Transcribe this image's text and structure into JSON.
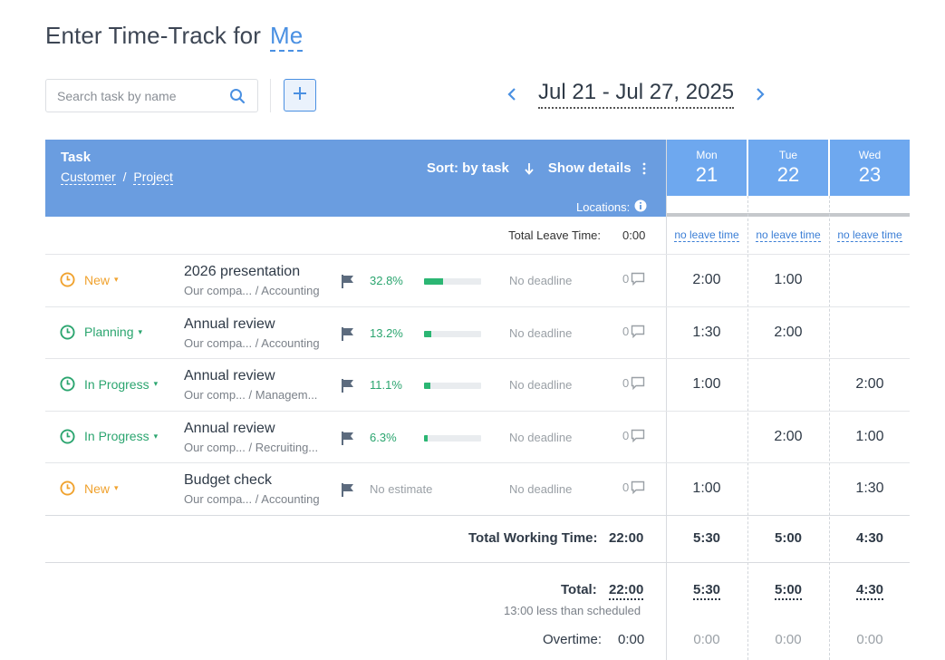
{
  "page": {
    "title": "Enter Time-Track for",
    "user_link": "Me"
  },
  "toolbar": {
    "search_placeholder": "Search task by name",
    "search_icon": "search-icon",
    "add_icon": "plus-icon"
  },
  "date_nav": {
    "range": "Jul 21 - Jul 27, 2025",
    "prev_icon": "chevron-left-icon",
    "next_icon": "chevron-right-icon"
  },
  "table_header": {
    "task": "Task",
    "customer": "Customer",
    "separator": "/",
    "project": "Project",
    "sort_label": "Sort: by task",
    "show_details": "Show details",
    "locations": "Locations:"
  },
  "days": [
    {
      "name": "Mon",
      "date": "21"
    },
    {
      "name": "Tue",
      "date": "22"
    },
    {
      "name": "Wed",
      "date": "23"
    }
  ],
  "leave": {
    "label": "Total Leave Time:",
    "value": "0:00",
    "days": [
      "no leave time",
      "no leave time",
      "no leave time"
    ]
  },
  "tasks": [
    {
      "status": "New",
      "status_color": "#f0a22e",
      "name": "2026 presentation",
      "customer": "Our compa...",
      "project": "/ Accounting",
      "estimate": "32.8%",
      "progress": 0.328,
      "deadline": "No deadline",
      "comments": "0",
      "times": [
        "2:00",
        "1:00",
        ""
      ]
    },
    {
      "status": "Planning",
      "status_color": "#2ba56f",
      "name": "Annual review",
      "customer": "Our compa...",
      "project": "/ Accounting",
      "estimate": "13.2%",
      "progress": 0.132,
      "deadline": "No deadline",
      "comments": "0",
      "times": [
        "1:30",
        "2:00",
        ""
      ]
    },
    {
      "status": "In Progress",
      "status_color": "#2ba56f",
      "name": "Annual review",
      "customer": "Our comp...",
      "project": "/ Managem...",
      "estimate": "11.1%",
      "progress": 0.111,
      "deadline": "No deadline",
      "comments": "0",
      "times": [
        "1:00",
        "",
        "2:00"
      ]
    },
    {
      "status": "In Progress",
      "status_color": "#2ba56f",
      "name": "Annual review",
      "customer": "Our comp...",
      "project": "/ Recruiting...",
      "estimate": "6.3%",
      "progress": 0.063,
      "deadline": "No deadline",
      "comments": "0",
      "times": [
        "",
        "2:00",
        "1:00"
      ]
    },
    {
      "status": "New",
      "status_color": "#f0a22e",
      "name": "Budget check",
      "customer": "Our compa...",
      "project": "/ Accounting",
      "estimate": "No estimate",
      "progress": null,
      "deadline": "No deadline",
      "comments": "0",
      "times": [
        "1:00",
        "",
        "1:30"
      ]
    }
  ],
  "totals": {
    "working_label": "Total Working Time:",
    "working_value": "22:00",
    "working_days": [
      "5:30",
      "5:00",
      "4:30"
    ],
    "total_label": "Total:",
    "total_value": "22:00",
    "total_days": [
      "5:30",
      "5:00",
      "4:30"
    ],
    "schedule_note": "13:00 less than scheduled",
    "overtime_label": "Overtime:",
    "overtime_value": "0:00",
    "overtime_days": [
      "0:00",
      "0:00",
      "0:00"
    ]
  },
  "colors": {
    "header_bg": "#6a9de0",
    "day_header_bg": "#6ea8ef",
    "accent": "#4a90e2",
    "progress_green": "#2bb673",
    "status_orange": "#f0a22e",
    "status_green": "#2ba56f"
  }
}
